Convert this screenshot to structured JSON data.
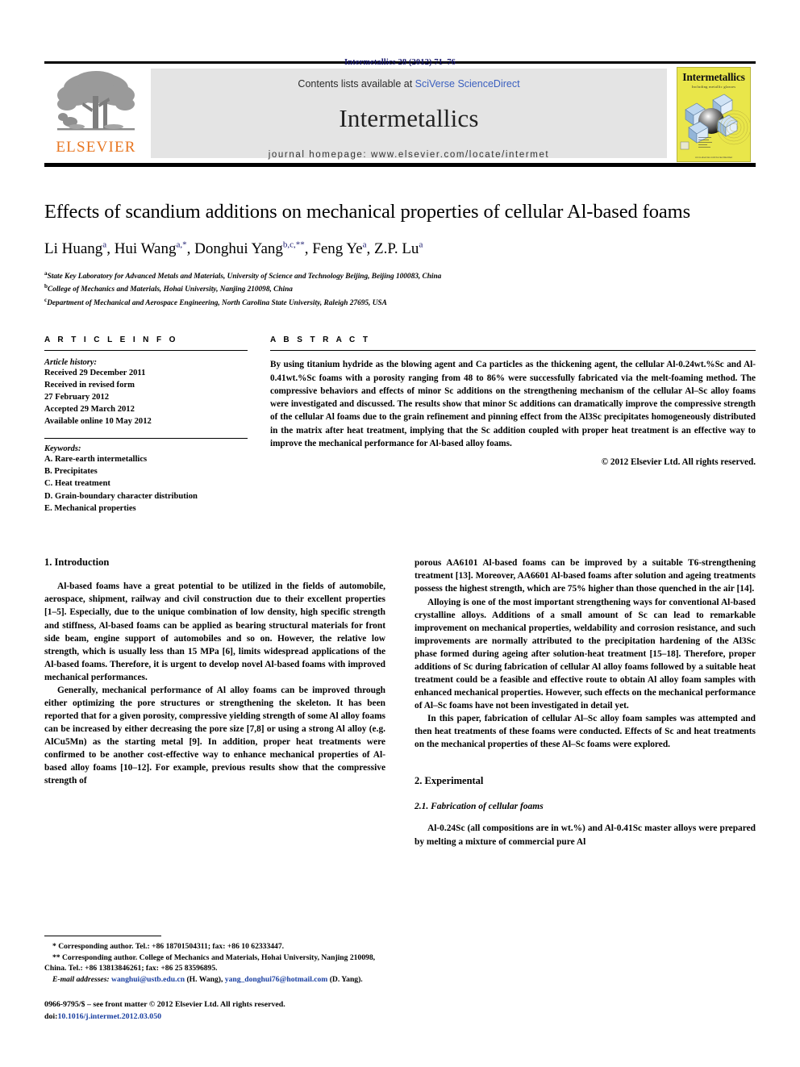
{
  "running_head": "Intermetallics 28 (2012) 71–76",
  "masthead": {
    "publisher_name": "ELSEVIER",
    "contents_prefix": "Contents lists available at ",
    "contents_link": "SciVerse ScienceDirect",
    "journal_name": "Intermetallics",
    "homepage": "journal homepage: www.elsevier.com/locate/intermet",
    "cover": {
      "title": "Intermetallics",
      "subtitle": "Including metallic glasses",
      "footer": "www.elsevier.com/locate/intermet"
    }
  },
  "article": {
    "title": "Effects of scandium additions on mechanical properties of cellular Al-based foams",
    "authors": [
      {
        "name": "Li Huang",
        "sup": "a"
      },
      {
        "name": "Hui Wang",
        "sup": "a,*"
      },
      {
        "name": "Donghui Yang",
        "sup": "b,c,**"
      },
      {
        "name": "Feng Ye",
        "sup": "a"
      },
      {
        "name": "Z.P. Lu",
        "sup": "a"
      }
    ],
    "affiliations": [
      {
        "marker": "a",
        "text": "State Key Laboratory for Advanced Metals and Materials, University of Science and Technology Beijing, Beijing 100083, China"
      },
      {
        "marker": "b",
        "text": "College of Mechanics and Materials, Hohai University, Nanjing 210098, China"
      },
      {
        "marker": "c",
        "text": "Department of Mechanical and Aerospace Engineering, North Carolina State University, Raleigh 27695, USA"
      }
    ]
  },
  "article_info": {
    "heading": "A R T I C L E   I N F O",
    "history_label": "Article history:",
    "history": [
      "Received 29 December 2011",
      "Received in revised form",
      "27 February 2012",
      "Accepted 29 March 2012",
      "Available online 10 May 2012"
    ],
    "keywords_label": "Keywords:",
    "keywords": [
      "A. Rare-earth intermetallics",
      "B. Precipitates",
      "C. Heat treatment",
      "D. Grain-boundary character distribution",
      "E. Mechanical properties"
    ]
  },
  "abstract": {
    "heading": "A B S T R A C T",
    "text": "By using titanium hydride as the blowing agent and Ca particles as the thickening agent, the cellular Al-0.24wt.%Sc and Al-0.41wt.%Sc foams with a porosity ranging from 48 to 86% were successfully fabricated via the melt-foaming method. The compressive behaviors and effects of minor Sc additions on the strengthening mechanism of the cellular Al–Sc alloy foams were investigated and discussed. The results show that minor Sc additions can dramatically improve the compressive strength of the cellular Al foams due to the grain refinement and pinning effect from the Al3Sc precipitates homogeneously distributed in the matrix after heat treatment, implying that the Sc addition coupled with proper heat treatment is an effective way to improve the mechanical performance for Al-based alloy foams.",
    "copyright": "© 2012 Elsevier Ltd. All rights reserved."
  },
  "body": {
    "section1_heading": "1.  Introduction",
    "left_paragraphs": [
      "Al-based foams have a great potential to be utilized in the fields of automobile, aerospace, shipment, railway and civil construction due to their excellent properties [1–5]. Especially, due to the unique combination of low density, high specific strength and stiffness, Al-based foams can be applied as bearing structural materials for front side beam, engine support of automobiles and so on. However, the relative low strength, which is usually less than 15 MPa [6], limits widespread applications of the Al-based foams. Therefore, it is urgent to develop novel Al-based foams with improved mechanical performances.",
      "Generally, mechanical performance of Al alloy foams can be improved through either optimizing the pore structures or strengthening the skeleton. It has been reported that for a given porosity, compressive yielding strength of some Al alloy foams can be increased by either decreasing the pore size [7,8] or using a strong Al alloy (e.g. AlCu5Mn) as the starting metal [9]. In addition, proper heat treatments were confirmed to be another cost-effective way to enhance mechanical properties of Al-based alloy foams [10–12]. For example, previous results show that the compressive strength of"
    ],
    "right_paragraphs": [
      "porous AA6101 Al-based foams can be improved by a suitable T6-strengthening treatment [13]. Moreover, AA6601 Al-based foams after solution and ageing treatments possess the highest strength, which are 75% higher than those quenched in the air [14].",
      "Alloying is one of the most important strengthening ways for conventional Al-based crystalline alloys. Additions of a small amount of Sc can lead to remarkable improvement on mechanical properties, weldability and corrosion resistance, and such improvements are normally attributed to the precipitation hardening of the Al3Sc phase formed during ageing after solution-heat treatment [15–18]. Therefore, proper additions of Sc during fabrication of cellular Al alloy foams followed by a suitable heat treatment could be a feasible and effective route to obtain Al alloy foam samples with enhanced mechanical properties. However, such effects on the mechanical performance of Al–Sc foams have not been investigated in detail yet.",
      "In this paper, fabrication of cellular Al–Sc alloy foam samples was attempted and then heat treatments of these foams were conducted. Effects of Sc and heat treatments on the mechanical properties of these Al–Sc foams were explored."
    ],
    "section2_heading": "2.  Experimental",
    "subsection21_heading": "2.1.  Fabrication of cellular foams",
    "right_paragraphs2": [
      "Al-0.24Sc (all compositions are in wt.%) and Al-0.41Sc master alloys were prepared by melting a mixture of commercial pure Al"
    ]
  },
  "footnotes": {
    "corresponding1": "*  Corresponding author. Tel.: +86 18701504311; fax: +86 10 62333447.",
    "corresponding2": "**  Corresponding author. College of Mechanics and Materials, Hohai University, Nanjing 210098, China. Tel.: +86 13813846261; fax: +86 25 83596895.",
    "email_label": "E-mail addresses:",
    "email1": "wanghui@ustb.edu.cn",
    "email1_owner": "(H. Wang),",
    "email2": "yang_donghui76@hotmail.com",
    "email2_owner": "(D. Yang).",
    "issn_line": "0966-9795/$ – see front matter © 2012 Elsevier Ltd. All rights reserved.",
    "doi_label": "doi:",
    "doi_value": "10.1016/j.intermet.2012.03.050"
  },
  "colors": {
    "header_blue": "#1a1a6e",
    "link_blue": "#3a5fbf",
    "ref_blue": "#1a3fa0",
    "elsevier_orange": "#E87722",
    "band_gray": "#e4e4e4",
    "cover_yellow": "#e9e64a"
  }
}
